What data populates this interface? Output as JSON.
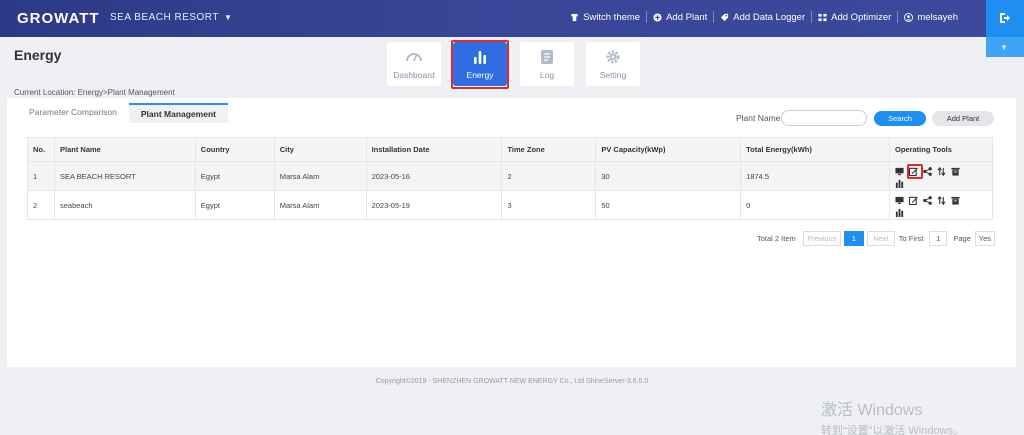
{
  "header": {
    "brand": "GROWATT",
    "plant_selector": "SEA BEACH RESORT",
    "actions": [
      {
        "label": "Switch theme",
        "icon": "shirt-icon"
      },
      {
        "label": "Add Plant",
        "icon": "plus-circle-icon"
      },
      {
        "label": "Add Data Logger",
        "icon": "tag-icon"
      },
      {
        "label": "Add Optimizer",
        "icon": "optimizer-icon"
      },
      {
        "label": "melsayeh",
        "icon": "user-icon"
      }
    ]
  },
  "page_title": "Energy",
  "nav_tiles": [
    {
      "label": "Dashboard",
      "icon": "gauge-icon",
      "active": false
    },
    {
      "label": "Energy",
      "icon": "bar-chart-icon",
      "active": true
    },
    {
      "label": "Log",
      "icon": "document-icon",
      "active": false
    },
    {
      "label": "Setting",
      "icon": "gear-icon",
      "active": false
    }
  ],
  "location": "Current Location: Energy>Plant Management",
  "tabs": [
    {
      "label": "Parameter Comparison",
      "active": false
    },
    {
      "label": "Plant Management",
      "active": true
    }
  ],
  "search": {
    "label": "Plant Name",
    "value": "",
    "search_label": "Search",
    "add_label": "Add Plant"
  },
  "table": {
    "columns": [
      "No.",
      "Plant Name",
      "Country",
      "City",
      "Installation Date",
      "Time Zone",
      "PV Capacity(kWp)",
      "Total Energy(kWh)",
      "Operating Tools"
    ],
    "rows": [
      [
        "1",
        "SEA BEACH RESORT",
        "Egypt",
        "Marsa Alam",
        "2023-05-16",
        "2",
        "30",
        "1874.5"
      ],
      [
        "2",
        "seabeach",
        "Egypt",
        "Marsa Alam",
        "2023-05-19",
        "3",
        "50",
        "0"
      ]
    ]
  },
  "pagination": {
    "total": "Total 2 Item",
    "previous": "Previous",
    "current": "1",
    "next": "Next",
    "to_first": "To First",
    "page_value": "1",
    "page_label": "Page",
    "yes": "Yes"
  },
  "footer": "Copyright©2019 - SHENZHEN GROWATT NEW ENERGY Co., Ltd ShineServer-3.6.0.0",
  "watermark": {
    "line1": "激活 Windows",
    "line2": "转到“设置”以激活 Windows。"
  },
  "colors": {
    "header": "#394597",
    "accent": "#1f8ef1",
    "active_tile": "#2f6ee2",
    "highlight": "#e02a2a"
  }
}
